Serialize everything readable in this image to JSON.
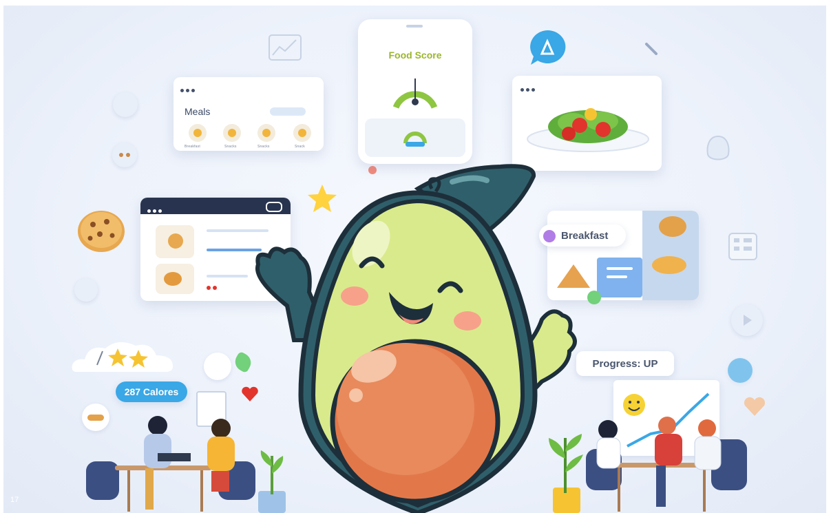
{
  "meals_card": {
    "title": "Meals",
    "items": [
      {
        "label": "Breakfast"
      },
      {
        "label": "Snacks"
      },
      {
        "label": "Snacks"
      },
      {
        "label": "Snack"
      }
    ]
  },
  "food_score_card": {
    "title": "Food Score"
  },
  "breakfast_card": {
    "title": "Breakfast"
  },
  "calories_bubble": {
    "text": "287 Calores"
  },
  "progress_bubble": {
    "text": "Progress: UP"
  },
  "corner_label": "17",
  "colors": {
    "background": "#edf2fb",
    "avocado_skin": "#2f5f6a",
    "avocado_flesh": "#d9ea8c",
    "avocado_pit": "#e2784a",
    "accent_green": "#8ec641",
    "food_score_title": "#9ab62d"
  }
}
